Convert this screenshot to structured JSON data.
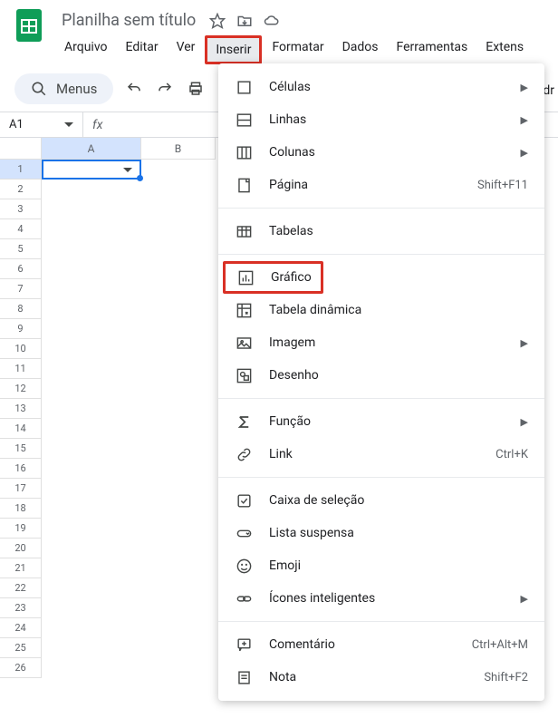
{
  "doc_title": "Planilha sem título",
  "menubar": [
    "Arquivo",
    "Editar",
    "Ver",
    "Inserir",
    "Formatar",
    "Dados",
    "Ferramentas",
    "Extens"
  ],
  "highlighted_menu_index": 3,
  "menus_pill": "Menus",
  "cell_ref": "A1",
  "fx_label": "fx",
  "columns": [
    "A",
    "B"
  ],
  "rows": [
    "1",
    "2",
    "3",
    "4",
    "5",
    "6",
    "7",
    "8",
    "9",
    "10",
    "11",
    "12",
    "13",
    "14",
    "15",
    "16",
    "17",
    "18",
    "19",
    "20",
    "21",
    "22",
    "23",
    "24",
    "25",
    "26"
  ],
  "edge_text": "dr",
  "menu": {
    "groups": [
      [
        {
          "icon": "cells",
          "label": "Células",
          "sub": true
        },
        {
          "icon": "rows",
          "label": "Linhas",
          "sub": true
        },
        {
          "icon": "cols",
          "label": "Colunas",
          "sub": true
        },
        {
          "icon": "page",
          "label": "Página",
          "shortcut": "Shift+F11"
        }
      ],
      [
        {
          "icon": "table",
          "label": "Tabelas"
        }
      ],
      [
        {
          "icon": "chart",
          "label": "Gráfico",
          "boxed": true
        },
        {
          "icon": "pivot",
          "label": "Tabela dinâmica"
        },
        {
          "icon": "image",
          "label": "Imagem",
          "sub": true
        },
        {
          "icon": "drawing",
          "label": "Desenho"
        }
      ],
      [
        {
          "icon": "sigma",
          "label": "Função",
          "sub": true
        },
        {
          "icon": "link",
          "label": "Link",
          "shortcut": "Ctrl+K"
        }
      ],
      [
        {
          "icon": "check",
          "label": "Caixa de seleção"
        },
        {
          "icon": "dropdown",
          "label": "Lista suspensa"
        },
        {
          "icon": "emoji",
          "label": "Emoji"
        },
        {
          "icon": "smart",
          "label": "Ícones inteligentes",
          "sub": true
        }
      ],
      [
        {
          "icon": "comment",
          "label": "Comentário",
          "shortcut": "Ctrl+Alt+M"
        },
        {
          "icon": "note",
          "label": "Nota",
          "shortcut": "Shift+F2"
        }
      ]
    ]
  }
}
